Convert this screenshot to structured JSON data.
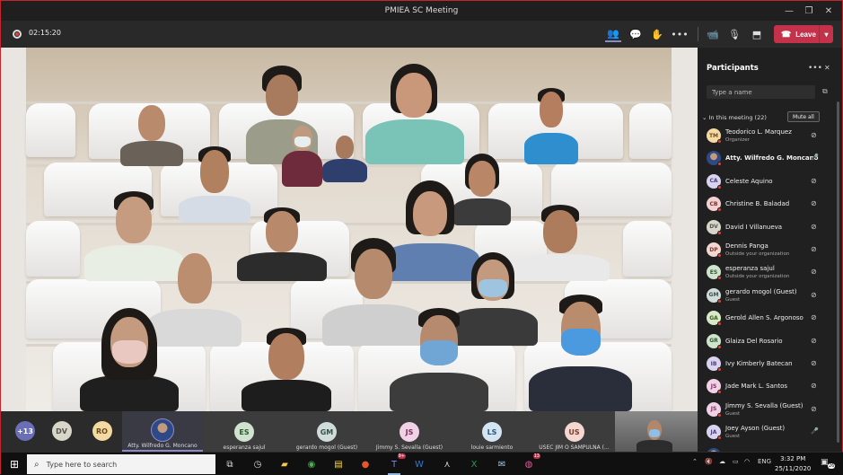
{
  "window": {
    "title": "PMIEA SC Meeting"
  },
  "toolbar": {
    "timer": "02:15:20",
    "leave_label": "Leave"
  },
  "colors": {
    "accent": "#8b8cc7",
    "leave": "#c4314b",
    "recording": "#e0463f",
    "border": "#c4262e"
  },
  "strip": {
    "overflow_count": "+13",
    "tiles": [
      {
        "initials": "DV",
        "name": "",
        "bg": "#d8d6c8",
        "fg": "#555"
      },
      {
        "initials": "RO",
        "name": "",
        "bg": "#f4d9a3",
        "fg": "#6b4c1c"
      },
      {
        "initials": "",
        "name": "Atty. Wilfredo G. Moncano",
        "bg": "",
        "fg": ""
      },
      {
        "initials": "ES",
        "name": "esperanza sajul",
        "bg": "#cfe3cf",
        "fg": "#2f5a2f"
      },
      {
        "initials": "GM",
        "name": "gerardo mogol (Guest)",
        "bg": "#d0dcd9",
        "fg": "#3a514c"
      },
      {
        "initials": "JS",
        "name": "Jimmy S. Sevalla (Guest)",
        "bg": "#f1d1e6",
        "fg": "#7a2e5d"
      },
      {
        "initials": "LS",
        "name": "louie sarmiento",
        "bg": "#d3e5f3",
        "fg": "#2d5676"
      },
      {
        "initials": "US",
        "name": "USEC JIM O SAMPULNA (...",
        "bg": "#f3d7d0",
        "fg": "#7a3b2e"
      }
    ]
  },
  "participants": {
    "title": "Participants",
    "search_placeholder": "Type a name",
    "section_label": "In this meeting (22)",
    "mute_all_label": "Mute all",
    "items": [
      {
        "initials": "TM",
        "name": "Teodorico L. Marquez",
        "sub": "Organizer",
        "bg": "#f4d9a3",
        "fg": "#6b4c1c",
        "mic": "muted"
      },
      {
        "initials": "",
        "name": "Atty. Wilfredo G. Moncano",
        "sub": "",
        "bg": "#8b9cc7",
        "fg": "#fff",
        "mic": "on"
      },
      {
        "initials": "CA",
        "name": "Celeste Aquino",
        "sub": "",
        "bg": "#d9d3ef",
        "fg": "#4b3f7a",
        "mic": "muted"
      },
      {
        "initials": "CB",
        "name": "Christine B. Baladad",
        "sub": "",
        "bg": "#f3d1d1",
        "fg": "#7a2e2e",
        "mic": "muted"
      },
      {
        "initials": "DV",
        "name": "David I Villanueva",
        "sub": "",
        "bg": "#d8d6c8",
        "fg": "#555",
        "mic": "muted"
      },
      {
        "initials": "DP",
        "name": "Dennis Panga",
        "sub": "Outside your organization",
        "bg": "#f3d7d0",
        "fg": "#7a3b2e",
        "mic": "muted"
      },
      {
        "initials": "ES",
        "name": "esperanza sajul",
        "sub": "Outside your organization",
        "bg": "#cfe3cf",
        "fg": "#2f5a2f",
        "mic": "muted"
      },
      {
        "initials": "GM",
        "name": "gerardo mogol (Guest)",
        "sub": "Guest",
        "bg": "#d0dcd9",
        "fg": "#3a514c",
        "mic": "muted"
      },
      {
        "initials": "GA",
        "name": "Gerold Allen S. Argonoso",
        "sub": "",
        "bg": "#d8e9c8",
        "fg": "#3b5a22",
        "mic": "muted"
      },
      {
        "initials": "GR",
        "name": "Glaiza Del Rosario",
        "sub": "",
        "bg": "#cfe3cf",
        "fg": "#2f5a2f",
        "mic": "muted"
      },
      {
        "initials": "IB",
        "name": "Ivy Kimberly Batecan",
        "sub": "",
        "bg": "#d9d3ef",
        "fg": "#4b3f7a",
        "mic": "muted"
      },
      {
        "initials": "JS",
        "name": "Jade Mark L. Santos",
        "sub": "",
        "bg": "#f1d1e6",
        "fg": "#7a2e5d",
        "mic": "muted"
      },
      {
        "initials": "JS",
        "name": "Jimmy S. Sevalla (Guest)",
        "sub": "Guest",
        "bg": "#f1d1e6",
        "fg": "#7a2e5d",
        "mic": "muted"
      },
      {
        "initials": "JA",
        "name": "Joey Ayson (Guest)",
        "sub": "Guest",
        "bg": "#d9d3ef",
        "fg": "#4b3f7a",
        "mic": "on"
      },
      {
        "initials": "",
        "name": "USEC JESUS P. PLAZA",
        "sub": "",
        "bg": "#f3d7d0",
        "fg": "#7a3b2e",
        "mic": "muted"
      }
    ]
  },
  "taskbar": {
    "search_placeholder": "Type here to search",
    "teams_badge": "9+",
    "chrome_badge": "13",
    "lang": "ENG",
    "time": "3:32 PM",
    "date": "25/11/2020",
    "notif_count": "26"
  }
}
